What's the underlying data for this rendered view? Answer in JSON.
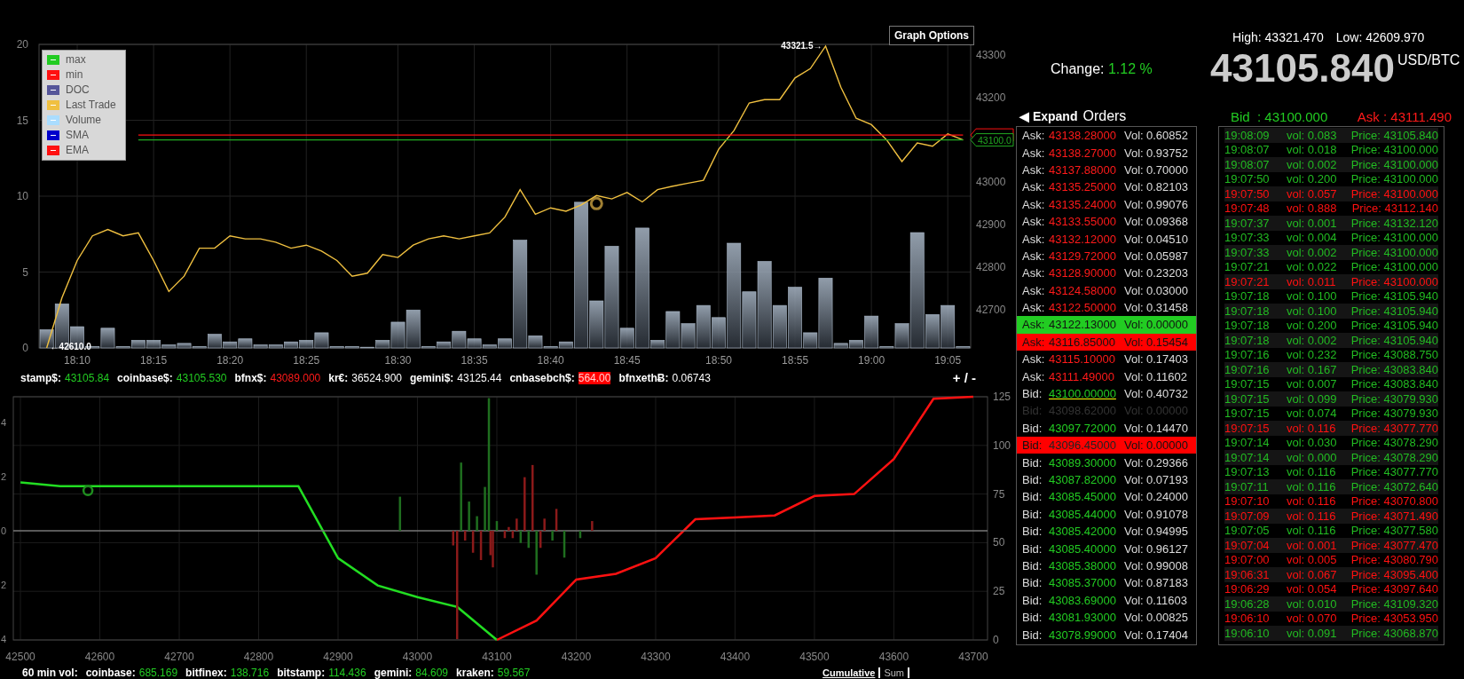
{
  "price_chart": {
    "graph_options": "Graph Options",
    "legend": [
      {
        "label": "max",
        "color": "#22cc22"
      },
      {
        "label": "min",
        "color": "#ff1111"
      },
      {
        "label": "DOC",
        "color": "#555599"
      },
      {
        "label": "Last Trade",
        "color": "#f0c040"
      },
      {
        "label": "Volume",
        "color": "#aaddff"
      },
      {
        "label": "SMA",
        "color": "#0000cc"
      },
      {
        "label": "EMA",
        "color": "#ff1111"
      }
    ],
    "markers": [
      {
        "kind": "max",
        "text": "43321.5→"
      },
      {
        "kind": "min",
        "text": "←42610.0"
      }
    ],
    "volume": {
      "chart_data": {
        "type": "bar",
        "grid": true,
        "ylim": [
          0,
          20
        ],
        "yticks": [
          0,
          5,
          10,
          15,
          20
        ],
        "categories": [
          null,
          null,
          null,
          null,
          null,
          null,
          null,
          null,
          null,
          null,
          null,
          null,
          null,
          null,
          null,
          null,
          null,
          null,
          null,
          null,
          null,
          null,
          null,
          null,
          null,
          null,
          null,
          null,
          null,
          null,
          null,
          null,
          null,
          null,
          null,
          null,
          null,
          null,
          null,
          null,
          null,
          null,
          null,
          null,
          null,
          null,
          null,
          null,
          null,
          null,
          null,
          null,
          null,
          null,
          null,
          null,
          null,
          null,
          null,
          null,
          null
        ],
        "series": [
          {
            "color": "#aab8c8",
            "values": [
              1.2,
              2.9,
              1.4,
              0.1,
              1.3,
              0.1,
              0.5,
              0.5,
              0.2,
              0.3,
              0.1,
              0.9,
              0.4,
              0.6,
              0.2,
              0.2,
              0.4,
              0.5,
              1.0,
              0.1,
              0.1,
              0.05,
              0.5,
              1.7,
              2.5,
              0.1,
              0.4,
              1.1,
              0.6,
              0.2,
              0.6,
              7.1,
              0.8,
              0.1,
              0.4,
              9.6,
              3.1,
              6.7,
              1.3,
              7.9,
              0.5,
              2.4,
              1.6,
              2.8,
              2.0,
              6.9,
              3.7,
              5.7,
              2.8,
              4.0,
              1.0,
              4.6,
              0.3,
              0.5,
              2.1,
              0.1,
              1.6,
              7.6,
              2.2,
              2.8,
              0.1
            ]
          }
        ]
      }
    },
    "last_trade": {
      "chart_data": {
        "type": "line",
        "ylim": [
          42610,
          43325
        ],
        "yticks": [
          42700,
          42800,
          42900,
          43000,
          43200,
          43300
        ],
        "categories": [
          null,
          null,
          "18:10",
          null,
          null,
          null,
          null,
          "18:15",
          null,
          null,
          null,
          null,
          "18:20",
          null,
          null,
          null,
          null,
          "18:25",
          null,
          null,
          null,
          null,
          null,
          "18:30",
          null,
          null,
          null,
          null,
          "18:35",
          null,
          null,
          null,
          null,
          "18:40",
          null,
          null,
          null,
          null,
          "18:45",
          null,
          null,
          null,
          null,
          null,
          "18:50",
          null,
          null,
          null,
          null,
          "18:55",
          null,
          null,
          null,
          null,
          "19:00",
          null,
          null,
          null,
          null,
          "19:05",
          null
        ],
        "series": [
          {
            "color": "#f0c040",
            "values": [
              42610,
              42728,
              42816,
              42874,
              42889,
              42874,
              42881,
              42816,
              42743,
              42779,
              42845,
              42845,
              42874,
              42867,
              42867,
              42859,
              42845,
              42852,
              42838,
              42816,
              42779,
              42786,
              42830,
              42823,
              42852,
              42867,
              42874,
              42867,
              42874,
              42881,
              42918,
              42983,
              42925,
              42940,
              42932,
              42947,
              42969,
              42961,
              42976,
              42954,
              42983,
              42991,
              42998,
              43005,
              43078,
              43122,
              43187,
              43195,
              43195,
              43246,
              43268,
              43321,
              43224,
              43151,
              43136,
              43100,
              43049,
              43093,
              43085,
              43114,
              43100
            ]
          },
          {
            "color": "#ff1111",
            "values": [
              null,
              null,
              null,
              null,
              null,
              null,
              43111.49,
              43111.49,
              43111.49,
              43111.49,
              43111.49,
              43111.49,
              43111.49,
              43111.49,
              43111.49,
              43111.49,
              43111.49,
              43111.49,
              43111.49,
              43111.49,
              43111.49,
              43111.49,
              43111.49,
              43111.49,
              43111.49,
              43111.49,
              43111.49,
              43111.49,
              43111.49,
              43111.49,
              43111.49,
              43111.49,
              43111.49,
              43111.49,
              43111.49,
              43111.49,
              43111.49,
              43111.49,
              43111.49,
              43111.49,
              43111.49,
              43111.49,
              43111.49,
              43111.49,
              43111.49,
              43111.49,
              43111.49,
              43111.49,
              43111.49,
              43111.49,
              43111.49,
              43111.49,
              43111.49,
              43111.49,
              43111.49,
              43111.49,
              43111.49,
              43111.49,
              43111.49,
              43111.49,
              43111.49
            ]
          },
          {
            "name": "43100.0",
            "color": "#22aa22",
            "values": [
              null,
              null,
              null,
              null,
              null,
              null,
              43100,
              43100,
              43100,
              43100,
              43100,
              43100,
              43100,
              43100,
              43100,
              43100,
              43100,
              43100,
              43100,
              43100,
              43100,
              43100,
              43100,
              43100,
              43100,
              43100,
              43100,
              43100,
              43100,
              43100,
              43100,
              43100,
              43100,
              43100,
              43100,
              43100,
              43100,
              43100,
              43100,
              43100,
              43100,
              43100,
              43100,
              43100,
              43100,
              43100,
              43100,
              43100,
              43100,
              43100,
              43100,
              43100,
              43100,
              43100,
              43100,
              43100,
              43100,
              43100,
              43100,
              43100,
              43100
            ]
          }
        ]
      }
    }
  },
  "ticker": [
    {
      "label": "stamp$:",
      "value": "43105.84",
      "color": "#22cc22",
      "highlighted": false
    },
    {
      "label": "coinbase$:",
      "value": "43105.530",
      "color": "#22cc22",
      "highlighted": false
    },
    {
      "label": "bfnx$:",
      "value": "43089.000",
      "color": "#ff1a1a",
      "highlighted": false
    },
    {
      "label": "kr€:",
      "value": "36524.900",
      "color": "#ffffff",
      "highlighted": false
    },
    {
      "label": "gemini$:",
      "value": "43125.44",
      "color": "#ffffff",
      "highlighted": false
    },
    {
      "label": "cnbasebch$:",
      "value": "564.00",
      "color": "#ff0000",
      "highlighted": true
    },
    {
      "label": "bfnxethɃ:",
      "value": "0.06743",
      "color": "#ffffff",
      "highlighted": false
    }
  ],
  "zoom_control": "+ / -",
  "depth_chart": {
    "depth": {
      "chart_data": {
        "type": "line",
        "grid": true,
        "xlim": [
          42491,
          43718
        ],
        "ylim": [
          0,
          125
        ],
        "yticks": [
          0,
          25,
          50,
          75,
          100,
          125
        ],
        "xticks": [
          42500,
          42600,
          42700,
          42800,
          42900,
          43000,
          43100,
          43200,
          43300,
          43400,
          43500,
          43600,
          43700
        ],
        "x": [
          42500,
          42550,
          42600,
          42650,
          42700,
          42750,
          42800,
          42850,
          42900,
          42950,
          43000,
          43050,
          43100,
          43150,
          43200,
          43250,
          43300,
          43350,
          43400,
          43450,
          43500,
          43550,
          43600,
          43650,
          43700
        ],
        "series": [
          {
            "color": "#22dd22",
            "values": [
              81,
              79,
              79,
              79,
              79,
              79,
              79,
              79,
              42,
              28,
              22,
              17,
              0,
              null,
              null,
              null,
              null,
              null,
              null,
              null,
              null,
              null,
              null,
              null,
              null
            ]
          },
          {
            "color": "#ff1111",
            "values": [
              null,
              null,
              null,
              null,
              null,
              null,
              null,
              null,
              null,
              null,
              null,
              null,
              0,
              10,
              31,
              34,
              42,
              62,
              63,
              64,
              74,
              75,
              93,
              124,
              125
            ]
          }
        ]
      }
    },
    "trades": {
      "chart_data": {
        "type": "bar",
        "xlim": [
          42491,
          43718
        ],
        "ylim": [
          -4.03,
          4.95
        ],
        "yticks": [
          {
            "value": 4,
            "label": "4"
          },
          {
            "value": 2,
            "label": "2"
          },
          0,
          {
            "value": -2,
            "label": "2"
          },
          {
            "value": -4,
            "label": "4"
          }
        ],
        "x": [
          42978,
          43045,
          43050,
          43055,
          43060,
          43065,
          43070,
          43075,
          43080,
          43085,
          43090,
          43092,
          43095,
          43100,
          43110,
          43115,
          43120,
          43125,
          43130,
          43135,
          43140,
          43145,
          43150,
          43155,
          43160,
          43170,
          43175,
          43185,
          43205,
          43220
        ],
        "series": [
          {
            "color": "#1f6e1f",
            "values": [
              1.26,
              null,
              null,
              2.52,
              null,
              1.08,
              null,
              0.54,
              null,
              1.62,
              4.9,
              null,
              null,
              0.36,
              null,
              null,
              null,
              null,
              -0.45,
              null,
              -0.63,
              null,
              -1.62,
              null,
              null,
              -0.36,
              null,
              -0.99,
              -0.27,
              null
            ]
          },
          {
            "color": "#8b1a1a",
            "values": [
              null,
              -0.54,
              -4.0,
              null,
              -0.36,
              null,
              -0.81,
              null,
              -1.08,
              null,
              null,
              -0.9,
              -1.35,
              null,
              -0.27,
              0.14,
              -0.27,
              0.45,
              null,
              1.98,
              null,
              2.43,
              null,
              -0.63,
              0.45,
              null,
              0.81,
              null,
              null,
              0.36
            ]
          }
        ]
      }
    }
  },
  "volume_60min": {
    "label": "60 min vol:",
    "items": [
      {
        "label": "coinbase:",
        "value": "685.169"
      },
      {
        "label": "bitfinex:",
        "value": "138.716"
      },
      {
        "label": "bitstamp:",
        "value": "114.436"
      },
      {
        "label": "gemini:",
        "value": "84.609"
      },
      {
        "label": "kraken:",
        "value": "59.567"
      }
    ]
  },
  "depth_tabs": [
    {
      "label": "Cumulative",
      "selected": true
    },
    {
      "label": "Sum",
      "selected": false
    }
  ],
  "summary": {
    "high": "High: 43321.470",
    "low": "Low: 42609.970",
    "change_label": "Change:",
    "change_value": "1.12 %",
    "last_price": "43105.840",
    "unit": "USD/BTC"
  },
  "orders": {
    "expand": "◀ Expand",
    "title": "Orders",
    "rows": [
      {
        "kind": "ask",
        "label": "Ask:",
        "price": "43138.28000",
        "vol_label": "Vol:",
        "vol": "0.60852",
        "highlighted": false,
        "dimmed": false,
        "underlined": false
      },
      {
        "kind": "ask",
        "label": "Ask:",
        "price": "43138.27000",
        "vol_label": "Vol:",
        "vol": "0.93752",
        "highlighted": false,
        "dimmed": false,
        "underlined": false
      },
      {
        "kind": "ask",
        "label": "Ask:",
        "price": "43137.88000",
        "vol_label": "Vol:",
        "vol": "0.70000",
        "highlighted": false,
        "dimmed": false,
        "underlined": false
      },
      {
        "kind": "ask",
        "label": "Ask:",
        "price": "43135.25000",
        "vol_label": "Vol:",
        "vol": "0.82103",
        "highlighted": false,
        "dimmed": false,
        "underlined": false
      },
      {
        "kind": "ask",
        "label": "Ask:",
        "price": "43135.24000",
        "vol_label": "Vol:",
        "vol": "0.99076",
        "highlighted": false,
        "dimmed": false,
        "underlined": false
      },
      {
        "kind": "ask",
        "label": "Ask:",
        "price": "43133.55000",
        "vol_label": "Vol:",
        "vol": "0.09368",
        "highlighted": false,
        "dimmed": false,
        "underlined": false
      },
      {
        "kind": "ask",
        "label": "Ask:",
        "price": "43132.12000",
        "vol_label": "Vol:",
        "vol": "0.04510",
        "highlighted": false,
        "dimmed": false,
        "underlined": false
      },
      {
        "kind": "ask",
        "label": "Ask:",
        "price": "43129.72000",
        "vol_label": "Vol:",
        "vol": "0.05987",
        "highlighted": false,
        "dimmed": false,
        "underlined": false
      },
      {
        "kind": "ask",
        "label": "Ask:",
        "price": "43128.90000",
        "vol_label": "Vol:",
        "vol": "0.23203",
        "highlighted": false,
        "dimmed": false,
        "underlined": false
      },
      {
        "kind": "ask",
        "label": "Ask:",
        "price": "43124.58000",
        "vol_label": "Vol:",
        "vol": "0.03000",
        "highlighted": false,
        "dimmed": false,
        "underlined": false
      },
      {
        "kind": "ask",
        "label": "Ask:",
        "price": "43122.50000",
        "vol_label": "Vol:",
        "vol": "0.31458",
        "highlighted": false,
        "dimmed": false,
        "underlined": false
      },
      {
        "kind": "ask",
        "label": "Ask:",
        "price": "43122.13000",
        "vol_label": "Vol:",
        "vol": "0.00000",
        "highlighted": true,
        "color": "#22cc22",
        "dimmed": false,
        "underlined": false
      },
      {
        "kind": "ask",
        "label": "Ask:",
        "price": "43116.85000",
        "vol_label": "Vol:",
        "vol": "0.15454",
        "highlighted": true,
        "color": "#ff0000",
        "dimmed": false,
        "underlined": false
      },
      {
        "kind": "ask",
        "label": "Ask:",
        "price": "43115.10000",
        "vol_label": "Vol:",
        "vol": "0.17403",
        "highlighted": false,
        "dimmed": false,
        "underlined": false
      },
      {
        "kind": "ask",
        "label": "Ask:",
        "price": "43111.49000",
        "vol_label": "Vol:",
        "vol": "0.11602",
        "highlighted": false,
        "dimmed": false,
        "underlined": false
      },
      {
        "kind": "bid",
        "label": "Bid:",
        "price": "43100.00000",
        "vol_label": "Vol:",
        "vol": "0.40732",
        "highlighted": false,
        "dimmed": false,
        "underlined": true
      },
      {
        "kind": "bid",
        "label": "Bid:",
        "price": "43098.62000",
        "vol_label": "Vol:",
        "vol": "0.00000",
        "highlighted": false,
        "dimmed": true,
        "underlined": false
      },
      {
        "kind": "bid",
        "label": "Bid:",
        "price": "43097.72000",
        "vol_label": "Vol:",
        "vol": "0.14470",
        "highlighted": false,
        "dimmed": false,
        "underlined": false
      },
      {
        "kind": "bid",
        "label": "Bid:",
        "price": "43096.45000",
        "vol_label": "Vol:",
        "vol": "0.00000",
        "highlighted": true,
        "color": "#ff0000",
        "dimmed": false,
        "underlined": false
      },
      {
        "kind": "bid",
        "label": "Bid:",
        "price": "43089.30000",
        "vol_label": "Vol:",
        "vol": "0.29366",
        "highlighted": false,
        "dimmed": false,
        "underlined": false
      },
      {
        "kind": "bid",
        "label": "Bid:",
        "price": "43087.82000",
        "vol_label": "Vol:",
        "vol": "0.07193",
        "highlighted": false,
        "dimmed": false,
        "underlined": false
      },
      {
        "kind": "bid",
        "label": "Bid:",
        "price": "43085.45000",
        "vol_label": "Vol:",
        "vol": "0.24000",
        "highlighted": false,
        "dimmed": false,
        "underlined": false
      },
      {
        "kind": "bid",
        "label": "Bid:",
        "price": "43085.44000",
        "vol_label": "Vol:",
        "vol": "0.91078",
        "highlighted": false,
        "dimmed": false,
        "underlined": false
      },
      {
        "kind": "bid",
        "label": "Bid:",
        "price": "43085.42000",
        "vol_label": "Vol:",
        "vol": "0.94995",
        "highlighted": false,
        "dimmed": false,
        "underlined": false
      },
      {
        "kind": "bid",
        "label": "Bid:",
        "price": "43085.40000",
        "vol_label": "Vol:",
        "vol": "0.96127",
        "highlighted": false,
        "dimmed": false,
        "underlined": false
      },
      {
        "kind": "bid",
        "label": "Bid:",
        "price": "43085.38000",
        "vol_label": "Vol:",
        "vol": "0.99008",
        "highlighted": false,
        "dimmed": false,
        "underlined": false
      },
      {
        "kind": "bid",
        "label": "Bid:",
        "price": "43085.37000",
        "vol_label": "Vol:",
        "vol": "0.87183",
        "highlighted": false,
        "dimmed": false,
        "underlined": false
      },
      {
        "kind": "bid",
        "label": "Bid:",
        "price": "43083.69000",
        "vol_label": "Vol:",
        "vol": "0.11603",
        "highlighted": false,
        "dimmed": false,
        "underlined": false
      },
      {
        "kind": "bid",
        "label": "Bid:",
        "price": "43081.93000",
        "vol_label": "Vol:",
        "vol": "0.00825",
        "highlighted": false,
        "dimmed": false,
        "underlined": false
      },
      {
        "kind": "bid",
        "label": "Bid:",
        "price": "43078.99000",
        "vol_label": "Vol:",
        "vol": "0.17404",
        "highlighted": false,
        "dimmed": false,
        "underlined": false
      }
    ]
  },
  "trades": {
    "best": [
      {
        "color": "#22cc22",
        "text": "Bid  : 43100.000"
      },
      {
        "color": "#ff1a1a",
        "text": "Ask : 43111.490"
      }
    ],
    "rows": [
      {
        "time": "19:08:09",
        "vol": "vol: 0.083",
        "price": "Price: 43105.840",
        "color": "#22bb22"
      },
      {
        "time": "19:08:07",
        "vol": "vol: 0.018",
        "price": "Price: 43100.000",
        "color": "#22bb22"
      },
      {
        "time": "19:08:07",
        "vol": "vol: 0.002",
        "price": "Price: 43100.000",
        "color": "#22bb22"
      },
      {
        "time": "19:07:50",
        "vol": "vol: 0.200",
        "price": "Price: 43100.000",
        "color": "#22bb22"
      },
      {
        "time": "19:07:50",
        "vol": "vol: 0.057",
        "price": "Price: 43100.000",
        "color": "#ff1111"
      },
      {
        "time": "19:07:48",
        "vol": "vol: 0.888",
        "price": "Price: 43112.140",
        "color": "#ff1111"
      },
      {
        "time": "19:07:37",
        "vol": "vol: 0.001",
        "price": "Price: 43132.120",
        "color": "#22bb22"
      },
      {
        "time": "19:07:33",
        "vol": "vol: 0.004",
        "price": "Price: 43100.000",
        "color": "#22bb22"
      },
      {
        "time": "19:07:33",
        "vol": "vol: 0.002",
        "price": "Price: 43100.000",
        "color": "#22bb22"
      },
      {
        "time": "19:07:21",
        "vol": "vol: 0.022",
        "price": "Price: 43100.000",
        "color": "#22bb22"
      },
      {
        "time": "19:07:21",
        "vol": "vol: 0.011",
        "price": "Price: 43100.000",
        "color": "#ff1111"
      },
      {
        "time": "19:07:18",
        "vol": "vol: 0.100",
        "price": "Price: 43105.940",
        "color": "#22bb22"
      },
      {
        "time": "19:07:18",
        "vol": "vol: 0.100",
        "price": "Price: 43105.940",
        "color": "#22bb22"
      },
      {
        "time": "19:07:18",
        "vol": "vol: 0.200",
        "price": "Price: 43105.940",
        "color": "#22bb22"
      },
      {
        "time": "19:07:18",
        "vol": "vol: 0.002",
        "price": "Price: 43105.940",
        "color": "#22bb22"
      },
      {
        "time": "19:07:16",
        "vol": "vol: 0.232",
        "price": "Price: 43088.750",
        "color": "#22bb22"
      },
      {
        "time": "19:07:16",
        "vol": "vol: 0.167",
        "price": "Price: 43083.840",
        "color": "#22bb22"
      },
      {
        "time": "19:07:15",
        "vol": "vol: 0.007",
        "price": "Price: 43083.840",
        "color": "#22bb22"
      },
      {
        "time": "19:07:15",
        "vol": "vol: 0.099",
        "price": "Price: 43079.930",
        "color": "#22bb22"
      },
      {
        "time": "19:07:15",
        "vol": "vol: 0.074",
        "price": "Price: 43079.930",
        "color": "#22bb22"
      },
      {
        "time": "19:07:15",
        "vol": "vol: 0.116",
        "price": "Price: 43077.770",
        "color": "#ff1111"
      },
      {
        "time": "19:07:14",
        "vol": "vol: 0.030",
        "price": "Price: 43078.290",
        "color": "#22bb22"
      },
      {
        "time": "19:07:14",
        "vol": "vol: 0.000",
        "price": "Price: 43078.290",
        "color": "#22bb22"
      },
      {
        "time": "19:07:13",
        "vol": "vol: 0.116",
        "price": "Price: 43077.770",
        "color": "#22bb22"
      },
      {
        "time": "19:07:11",
        "vol": "vol: 0.116",
        "price": "Price: 43072.640",
        "color": "#22bb22"
      },
      {
        "time": "19:07:10",
        "vol": "vol: 0.116",
        "price": "Price: 43070.800",
        "color": "#ff1111"
      },
      {
        "time": "19:07:09",
        "vol": "vol: 0.116",
        "price": "Price: 43071.490",
        "color": "#ff1111"
      },
      {
        "time": "19:07:05",
        "vol": "vol: 0.116",
        "price": "Price: 43077.580",
        "color": "#22bb22"
      },
      {
        "time": "19:07:04",
        "vol": "vol: 0.001",
        "price": "Price: 43077.470",
        "color": "#ff1111"
      },
      {
        "time": "19:07:00",
        "vol": "vol: 0.005",
        "price": "Price: 43080.790",
        "color": "#ff1111"
      },
      {
        "time": "19:06:31",
        "vol": "vol: 0.067",
        "price": "Price: 43095.400",
        "color": "#ff1111"
      },
      {
        "time": "19:06:29",
        "vol": "vol: 0.054",
        "price": "Price: 43097.640",
        "color": "#ff1111"
      },
      {
        "time": "19:06:28",
        "vol": "vol: 0.010",
        "price": "Price: 43109.320",
        "color": "#22bb22"
      },
      {
        "time": "19:06:10",
        "vol": "vol: 0.070",
        "price": "Price: 43053.950",
        "color": "#ff1111"
      },
      {
        "time": "19:06:10",
        "vol": "vol: 0.091",
        "price": "Price: 43068.870",
        "color": "#22bb22"
      }
    ]
  }
}
